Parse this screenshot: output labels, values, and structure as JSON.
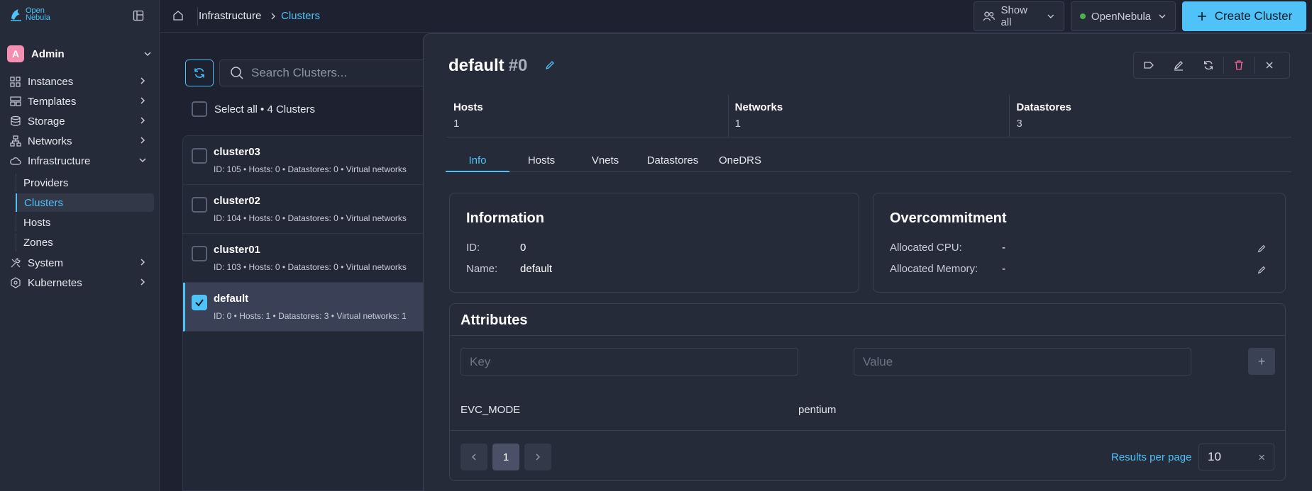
{
  "brand": {
    "logo_text_1": "Open",
    "logo_text_2": "Nebula"
  },
  "user": {
    "initial": "A",
    "name": "Admin"
  },
  "sidebar": {
    "items": [
      {
        "label": "Instances"
      },
      {
        "label": "Templates"
      },
      {
        "label": "Storage"
      },
      {
        "label": "Networks"
      },
      {
        "label": "Infrastructure"
      },
      {
        "label": "System"
      },
      {
        "label": "Kubernetes"
      }
    ],
    "sub_items": [
      {
        "label": "Providers"
      },
      {
        "label": "Clusters"
      },
      {
        "label": "Hosts"
      },
      {
        "label": "Zones"
      }
    ]
  },
  "breadcrumb": {
    "parent": "Infrastructure",
    "current": "Clusters"
  },
  "topbar": {
    "show_all": "Show all",
    "zone": "OpenNebula",
    "create": "Create Cluster"
  },
  "list": {
    "search_placeholder": "Search Clusters...",
    "select_all": "Select all • 4 Clusters",
    "rows": [
      {
        "name": "cluster03",
        "meta": "ID: 105  •  Hosts: 0  •  Datastores: 0  •  Virtual networks"
      },
      {
        "name": "cluster02",
        "meta": "ID: 104  •  Hosts: 0  •  Datastores: 0  •  Virtual networks"
      },
      {
        "name": "cluster01",
        "meta": "ID: 103  •  Hosts: 0  •  Datastores: 0  •  Virtual networks"
      },
      {
        "name": "default",
        "meta": "ID: 0  •  Hosts: 1  •  Datastores: 3  •  Virtual networks: 1"
      }
    ]
  },
  "detail": {
    "name": "default",
    "id": "#0",
    "stats": [
      {
        "label": "Hosts",
        "value": "1"
      },
      {
        "label": "Networks",
        "value": "1"
      },
      {
        "label": "Datastores",
        "value": "3"
      }
    ],
    "tabs": [
      "Info",
      "Hosts",
      "Vnets",
      "Datastores",
      "OneDRS"
    ],
    "information": {
      "title": "Information",
      "id_label": "ID:",
      "id_value": "0",
      "name_label": "Name:",
      "name_value": "default"
    },
    "overcommitment": {
      "title": "Overcommitment",
      "cpu_label": "Allocated CPU:",
      "cpu_value": "-",
      "mem_label": "Allocated Memory:",
      "mem_value": "-"
    },
    "attributes": {
      "title": "Attributes",
      "key_placeholder": "Key",
      "value_placeholder": "Value",
      "add": "+",
      "rows": [
        {
          "key": "EVC_MODE",
          "value": "pentium"
        }
      ],
      "page": "1",
      "results_per_page_label": "Results per page",
      "results_per_page": "10"
    }
  },
  "colors": {
    "accent": "#4fc3f7",
    "bg": "#1d2130",
    "panel": "#262b3a",
    "danger": "#f06292",
    "online": "#4caf50"
  }
}
